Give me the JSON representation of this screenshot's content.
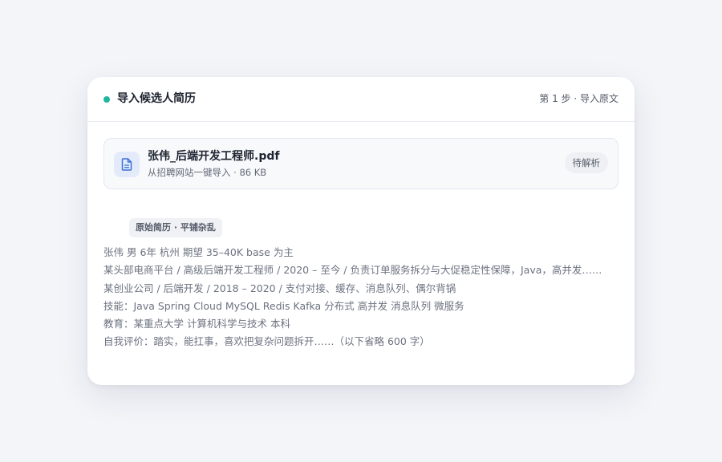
{
  "header": {
    "title": "导入候选人简历",
    "step": "第 1 步 · 导入原文",
    "status_color": "#1fb59e"
  },
  "file": {
    "icon": "document-icon",
    "name": "张伟_后端开发工程师.pdf",
    "meta": "从招聘网站一键导入 · 86 KB",
    "status": "待解析"
  },
  "raw": {
    "tag": "原始简历 · 平铺杂乱",
    "lines": [
      "张伟  男  6年  杭州  期望 35–40K  base 为主",
      "某头部电商平台 / 高级后端开发工程师 / 2020 – 至今 / 负责订单服务拆分与大促稳定性保障，Java，高并发……",
      "某创业公司 / 后端开发 / 2018 – 2020 / 支付对接、缓存、消息队列、偶尔背锅",
      "技能：Java Spring Cloud MySQL Redis Kafka 分布式 高并发 消息队列 微服务",
      "教育：某重点大学 计算机科学与技术 本科",
      "自我评价：踏实，能扛事，喜欢把复杂问题拆开……（以下省略 600 字）"
    ]
  }
}
